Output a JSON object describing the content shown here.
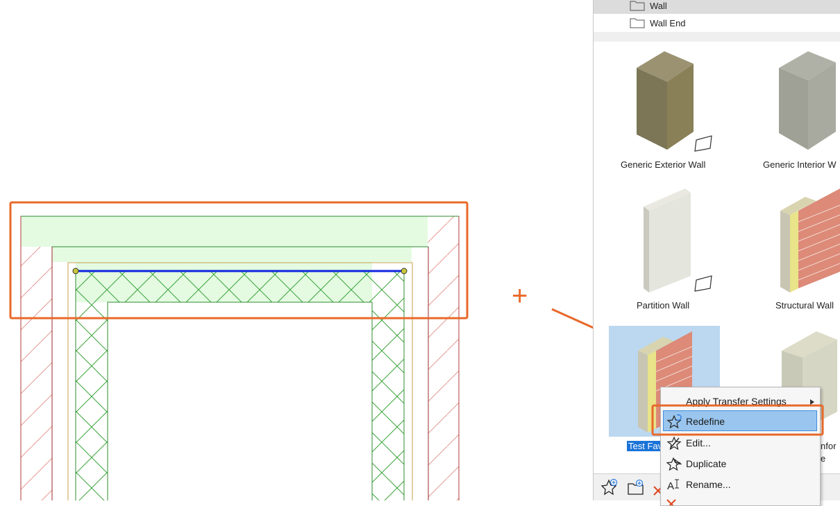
{
  "favorites_panel": {
    "folders": [
      {
        "label": "Wall"
      },
      {
        "label": "Wall End"
      }
    ],
    "tiles": [
      {
        "label": "Generic Exterior Wall"
      },
      {
        "label": "Generic Interior W"
      },
      {
        "label": "Partition Wall"
      },
      {
        "label": "Structural Wall"
      },
      {
        "label": "Test Fav"
      },
      {
        "label": "nfor"
      },
      {
        "label": "e"
      }
    ]
  },
  "context_menu": {
    "items": [
      {
        "label": "Apply Transfer Settings"
      },
      {
        "label": "Redefine"
      },
      {
        "label": "Edit..."
      },
      {
        "label": "Duplicate"
      },
      {
        "label": "Rename..."
      }
    ]
  },
  "annotation": {
    "plus_symbol": "+",
    "highlight_color": "#e8692a"
  }
}
